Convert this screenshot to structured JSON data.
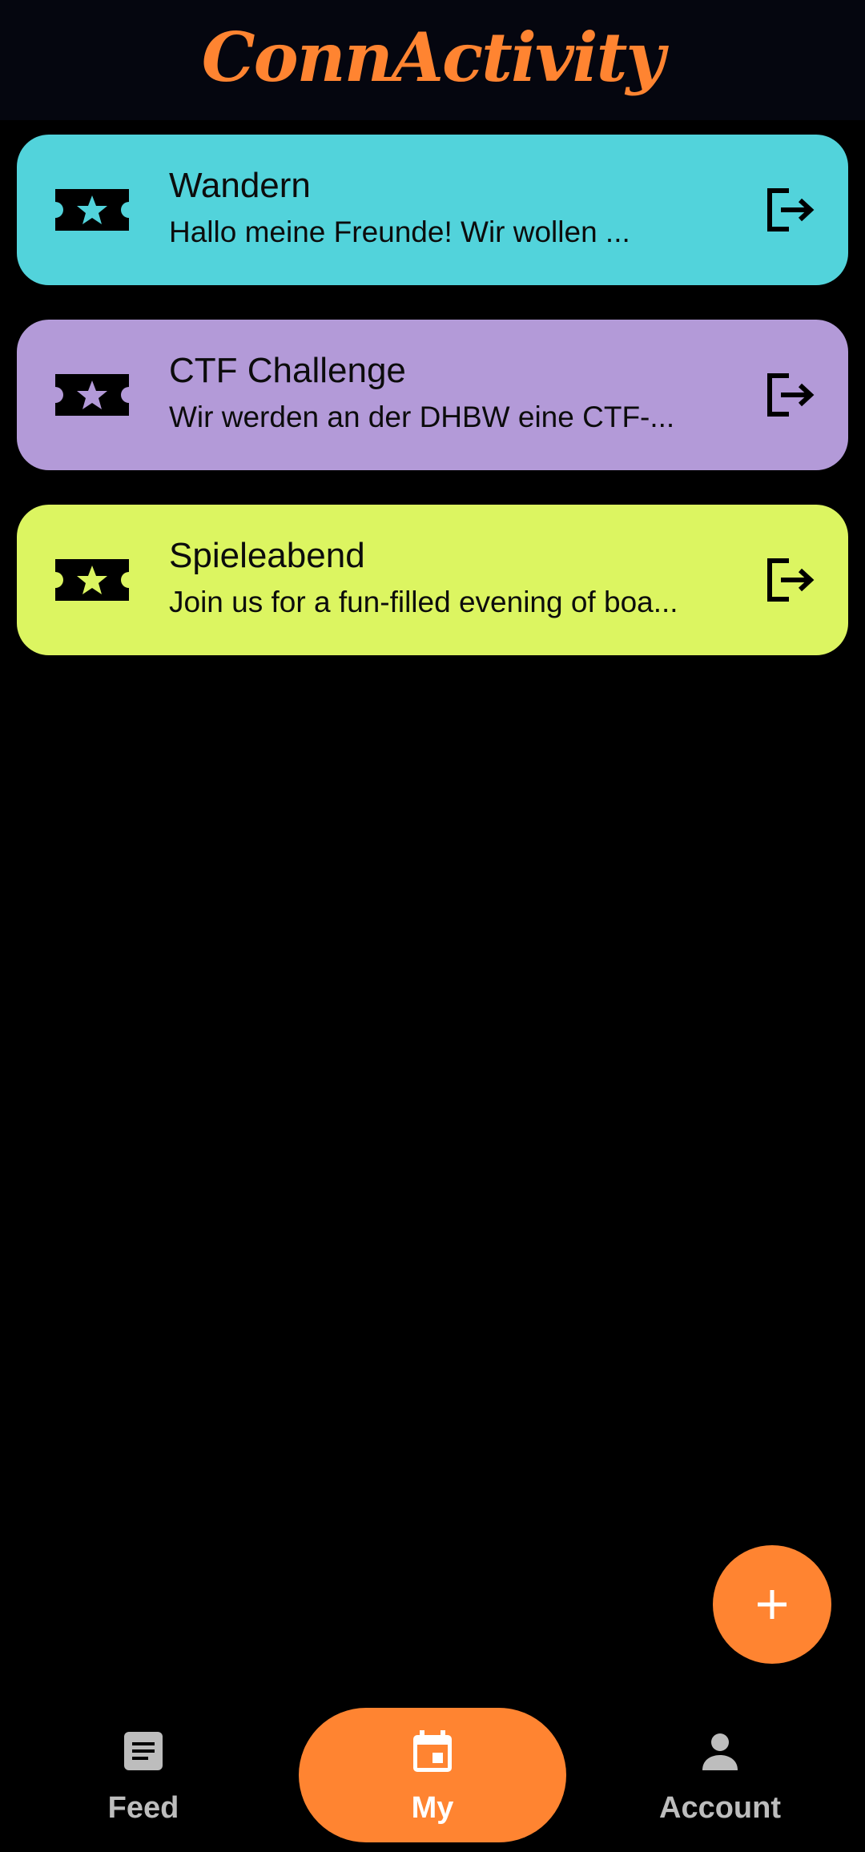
{
  "header": {
    "title": "ConnActivity",
    "title_color": "#ff8431"
  },
  "activities": [
    {
      "icon": "ticket-star-icon",
      "title": "Wandern",
      "description": "Hallo meine Freunde! Wir wollen ...",
      "color": "#52d3db",
      "action_icon": "logout-icon"
    },
    {
      "icon": "ticket-star-icon",
      "title": "CTF Challenge",
      "description": "Wir werden an der DHBW eine CTF-...",
      "color": "#b39ad8",
      "action_icon": "logout-icon"
    },
    {
      "icon": "ticket-star-icon",
      "title": "Spieleabend",
      "description": "Join us for a fun-filled evening of boa...",
      "color": "#dcf561",
      "action_icon": "logout-icon"
    }
  ],
  "fab": {
    "icon": "plus-icon",
    "color": "#ff8431"
  },
  "bottom_nav": {
    "items": [
      {
        "label": "Feed",
        "icon": "article-icon",
        "active": false
      },
      {
        "label": "My",
        "icon": "calendar-icon",
        "active": true
      },
      {
        "label": "Account",
        "icon": "person-icon",
        "active": false
      }
    ],
    "active_color": "#ff8431"
  }
}
